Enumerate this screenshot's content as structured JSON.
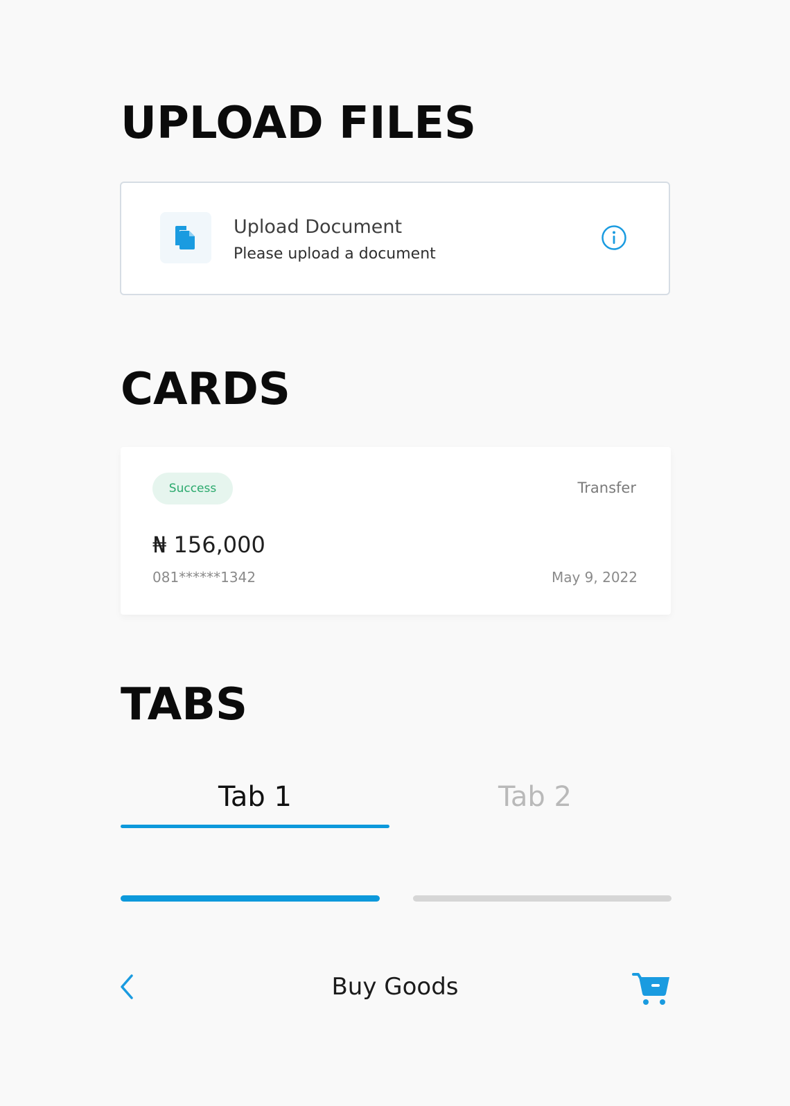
{
  "sections": {
    "upload_title": "UPLOAD FILES",
    "cards_title": "CARDS",
    "tabs_title": "TABS"
  },
  "upload": {
    "title": "Upload Document",
    "subtitle": "Please upload a document",
    "icon": "document-icon",
    "info_icon": "info-icon"
  },
  "transaction_card": {
    "status": "Success",
    "type": "Transfer",
    "amount": "₦ 156,000",
    "account": "081******1342",
    "date": "May 9, 2022"
  },
  "tabs": [
    {
      "label": "Tab 1",
      "active": true
    },
    {
      "label": "Tab 2",
      "active": false
    }
  ],
  "progress": {
    "steps_total": 2,
    "steps_completed": 1
  },
  "bottom_bar": {
    "title": "Buy Goods",
    "back_icon": "chevron-left-icon",
    "cart_icon": "cart-icon"
  },
  "colors": {
    "accent": "#0d99db",
    "success_text": "#2aa96c",
    "success_bg": "#e6f5ee",
    "inactive_tab": "#b9b9b9",
    "inactive_segment": "#d6d6d6"
  }
}
